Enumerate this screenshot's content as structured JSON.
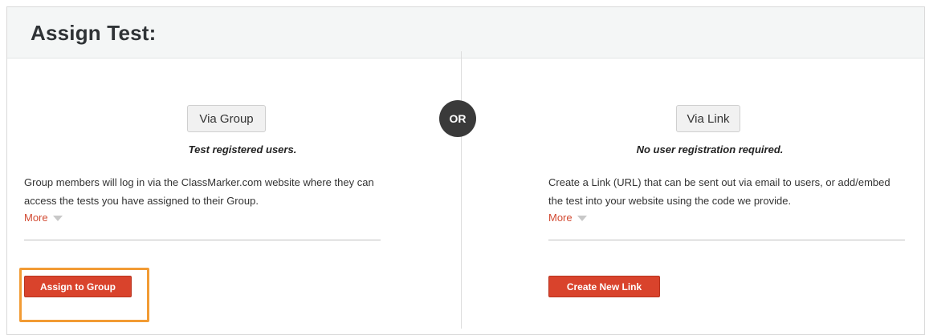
{
  "header": {
    "title": "Assign Test:"
  },
  "separator": {
    "label": "OR"
  },
  "left": {
    "option_label": "Via Group",
    "subtitle": "Test registered users.",
    "description": "Group members will log in via the ClassMarker.com website where they can access the tests you have assigned to their Group.",
    "more_label": "More",
    "action_label": "Assign to Group"
  },
  "right": {
    "option_label": "Via Link",
    "subtitle": "No user registration required.",
    "description": "Create a Link (URL) that can be sent out via email to users, or add/embed the test into your website using the code we provide.",
    "more_label": "More",
    "action_label": "Create New Link"
  },
  "colors": {
    "accent": "#d9432c",
    "highlight": "#f29b34",
    "header_bg": "#f4f6f6",
    "badge_bg": "#3a3a3a"
  }
}
